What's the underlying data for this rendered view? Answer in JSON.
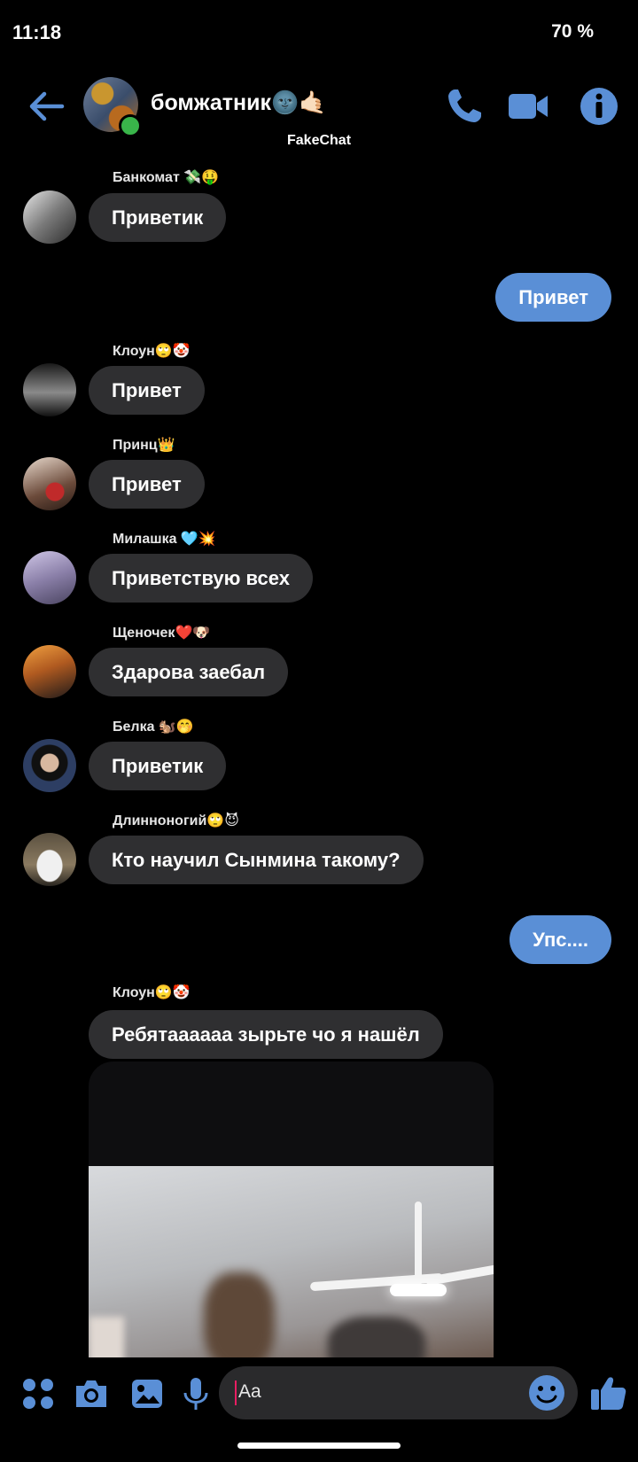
{
  "status_bar": {
    "time": "11:18",
    "battery": "70 %"
  },
  "header": {
    "title": "бомжатник🌚🤙🏻",
    "subtitle": "FakeChat",
    "accent": "#5a8fd6",
    "icons": [
      "back-arrow-icon",
      "phone-icon",
      "video-camera-icon",
      "info-icon"
    ]
  },
  "messages": [
    {
      "sender": "Банкомат 💸🤑",
      "text": "Приветик"
    },
    {
      "outgoing": true,
      "text": "Привет"
    },
    {
      "sender": "Клоун🙄🤡",
      "text": "Привет"
    },
    {
      "sender": "Принц👑",
      "text": "Привет"
    },
    {
      "sender": "Милашка 🩵💥",
      "text": "Приветствую всех"
    },
    {
      "sender": "Щеночек❤️🐶",
      "text": "Здарова заебал"
    },
    {
      "sender": "Белка 🐿️🤭",
      "text": "Приветик"
    },
    {
      "sender": "Длинноногий🙄😈",
      "text": "Кто научил Сынмина такому?"
    },
    {
      "outgoing": true,
      "text": "Упс...."
    },
    {
      "sender": "Клоун🙄🤡",
      "text": "Ребятаааааа зырьте чо я нашёл"
    }
  ],
  "composer": {
    "placeholder": "Aa"
  },
  "bottom_icons": [
    "apps-grid-icon",
    "camera-icon",
    "gallery-icon",
    "microphone-icon",
    "emoji-icon",
    "thumbs-up-icon"
  ]
}
